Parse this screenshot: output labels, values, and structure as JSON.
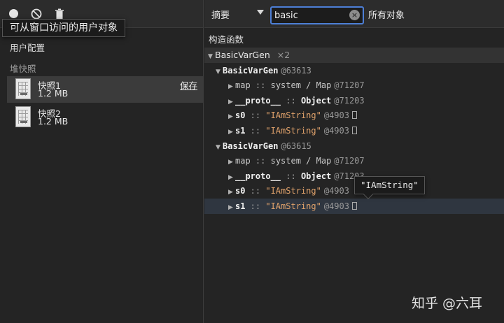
{
  "tooltip_top": "可从窗口访问的用户对象",
  "sidebar": {
    "profiles_heading": "用户配置",
    "heap_heading": "堆快照",
    "snapshots": [
      {
        "title": "快照1",
        "size": "1.2 MB",
        "action": "保存"
      },
      {
        "title": "快照2",
        "size": "1.2 MB"
      }
    ]
  },
  "toolbar": {
    "view": "摘要",
    "filter_value": "basic",
    "objects": "所有对象"
  },
  "grid": {
    "column_header": "构造函数",
    "group": {
      "name": "BasicVarGen",
      "count": "×2"
    },
    "instances": [
      {
        "name": "BasicVarGen",
        "id": "@63613",
        "props": [
          {
            "key": "map",
            "sep": " :: ",
            "value": "system / Map",
            "addr": "@71207"
          },
          {
            "key": "__proto__",
            "sep": " :: ",
            "value": "Object",
            "addr": "@71203"
          },
          {
            "key": "s0",
            "sep": " :: ",
            "value": "\"IAmString\"",
            "addr": "@4903"
          },
          {
            "key": "s1",
            "sep": " :: ",
            "value": "\"IAmString\"",
            "addr": "@4903"
          }
        ]
      },
      {
        "name": "BasicVarGen",
        "id": "@63615",
        "props": [
          {
            "key": "map",
            "sep": " :: ",
            "value": "system / Map",
            "addr": "@71207"
          },
          {
            "key": "__proto__",
            "sep": " :: ",
            "value": "Object",
            "addr": "@71203"
          },
          {
            "key": "s0",
            "sep": " :: ",
            "value": "\"IAmString\"",
            "addr": "@4903"
          },
          {
            "key": "s1",
            "sep": " :: ",
            "value": "\"IAmString\"",
            "addr": "@4903"
          }
        ]
      }
    ]
  },
  "value_tooltip": "\"IAmString\"",
  "watermark": "知乎 @六耳",
  "colors": {
    "string_value": "#e0a26b",
    "focus_border": "#4d7fd6",
    "background": "#242424"
  },
  "icons": [
    "record-icon",
    "clear-icon",
    "trash-icon",
    "snapshot-icon",
    "chevron-down-icon",
    "clear-search-icon",
    "expand-triangle-icon"
  ]
}
